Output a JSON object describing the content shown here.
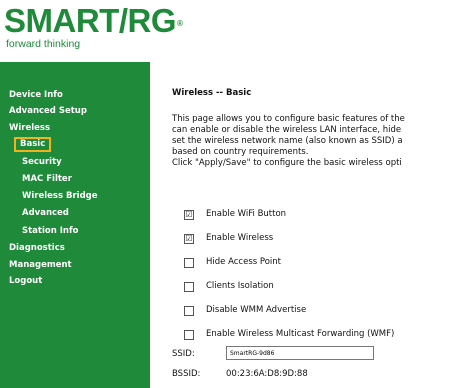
{
  "header": {
    "logo": "SMART/RG",
    "logo_mark": "®",
    "tagline": "forward thinking"
  },
  "sidebar": {
    "items": [
      {
        "label": "Device Info"
      },
      {
        "label": "Advanced Setup"
      },
      {
        "label": "Wireless"
      },
      {
        "label": "Basic"
      },
      {
        "label": "Security"
      },
      {
        "label": "MAC Filter"
      },
      {
        "label": "Wireless Bridge"
      },
      {
        "label": "Advanced"
      },
      {
        "label": "Station Info"
      },
      {
        "label": "Diagnostics"
      },
      {
        "label": "Management"
      },
      {
        "label": "Logout"
      }
    ],
    "selected_label": "Basic"
  },
  "main": {
    "title": "Wireless -- Basic",
    "description": [
      "This page allows you to configure basic features of the",
      "can enable or disable the wireless LAN interface, hide",
      "set the wireless network name (also known as SSID) a",
      "based on country requirements.",
      "Click \"Apply/Save\" to configure the basic wireless opti"
    ],
    "options": [
      {
        "label": "Enable WiFi Button",
        "checked": true,
        "mark": "☑"
      },
      {
        "label": "Enable Wireless",
        "checked": true,
        "mark": "☑"
      },
      {
        "label": "Hide Access Point",
        "checked": false,
        "mark": ""
      },
      {
        "label": "Clients Isolation",
        "checked": false,
        "mark": ""
      },
      {
        "label": "Disable WMM Advertise",
        "checked": false,
        "mark": ""
      },
      {
        "label": "Enable Wireless Multicast Forwarding (WMF)",
        "checked": false,
        "mark": ""
      }
    ],
    "ssid_label": "SSID:",
    "ssid_value": "SmartRG-9d86",
    "bssid_label": "BSSID:",
    "bssid_value": "00:23:6A:D8:9D:88"
  },
  "colors": {
    "brand_green": "#1f8a3a",
    "selected_outline": "#f2b21c"
  }
}
